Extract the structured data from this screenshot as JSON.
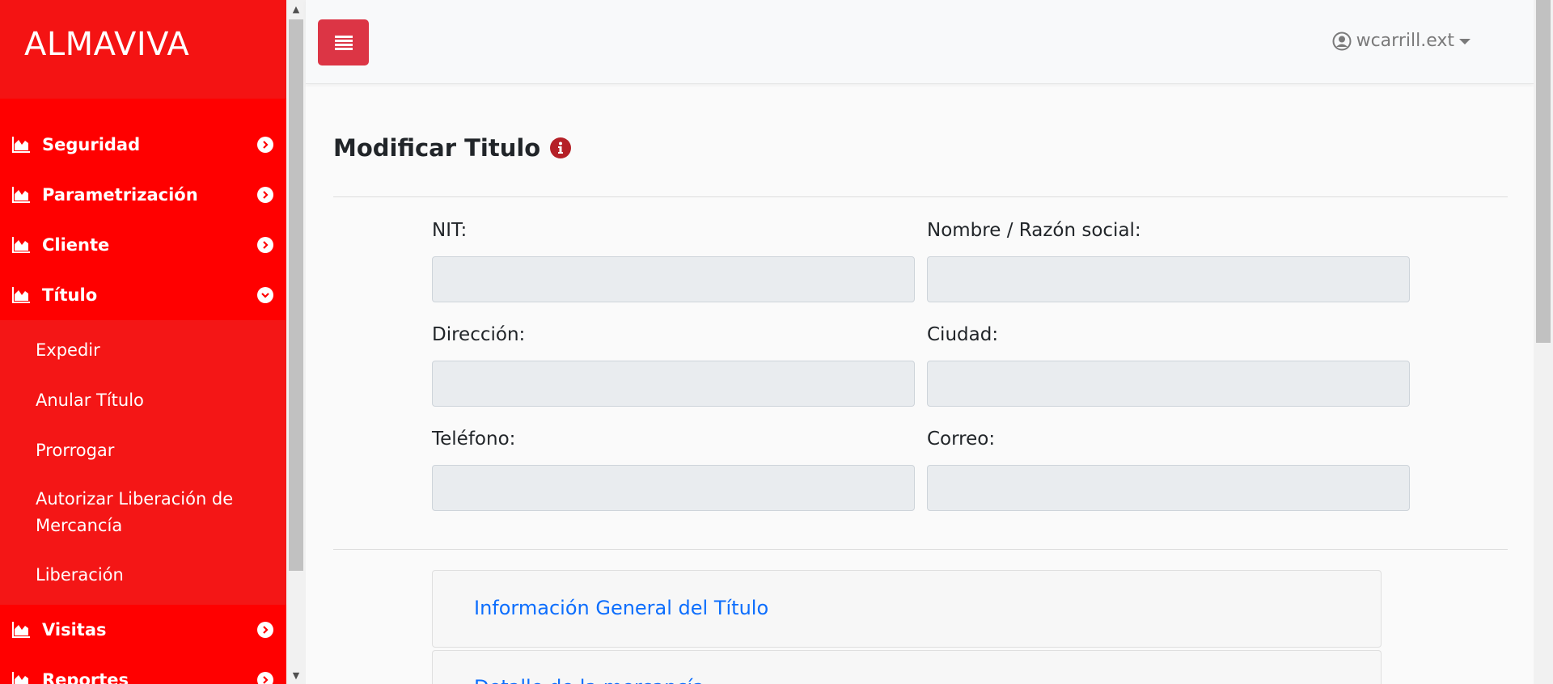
{
  "brand": {
    "title": "ALMAVIVA",
    "color": "#ff0000"
  },
  "sidebar": {
    "items": [
      {
        "label": "Seguridad",
        "icon": "chart-area-icon",
        "state": "collapsed"
      },
      {
        "label": "Parametrización",
        "icon": "chart-area-icon",
        "state": "collapsed"
      },
      {
        "label": "Cliente",
        "icon": "chart-area-icon",
        "state": "collapsed"
      },
      {
        "label": "Título",
        "icon": "chart-area-icon",
        "state": "expanded"
      }
    ],
    "titulo_sub": [
      {
        "label": "Expedir"
      },
      {
        "label": "Anular Título"
      },
      {
        "label": "Prorrogar"
      },
      {
        "label": "Autorizar Liberación de Mercancía"
      },
      {
        "label": "Liberación"
      }
    ],
    "items_after": [
      {
        "label": "Visitas",
        "icon": "chart-area-icon",
        "state": "collapsed"
      },
      {
        "label": "Reportes",
        "icon": "chart-area-icon",
        "state": "collapsed"
      }
    ]
  },
  "topbar": {
    "toggle_icon": "menu-icon",
    "toggle_color": "#dc3545",
    "user": {
      "name": "wcarrill.ext",
      "icon": "user-circle-icon"
    }
  },
  "main": {
    "title": "Modificar Titulo",
    "title_icon": "info-circle-icon",
    "form": {
      "nit_label": "NIT:",
      "nombre_label": "Nombre / Razón social:",
      "direccion_label": "Dirección:",
      "ciudad_label": "Ciudad:",
      "telefono_label": "Teléfono:",
      "correo_label": "Correo:",
      "nit_value": "",
      "nombre_value": "",
      "direccion_value": "",
      "ciudad_value": "",
      "telefono_value": "",
      "correo_value": ""
    },
    "accordion": [
      {
        "label": "Información General del Título"
      },
      {
        "label": "Detalle de la mercancía"
      }
    ],
    "link_color": "#0d6efd"
  }
}
